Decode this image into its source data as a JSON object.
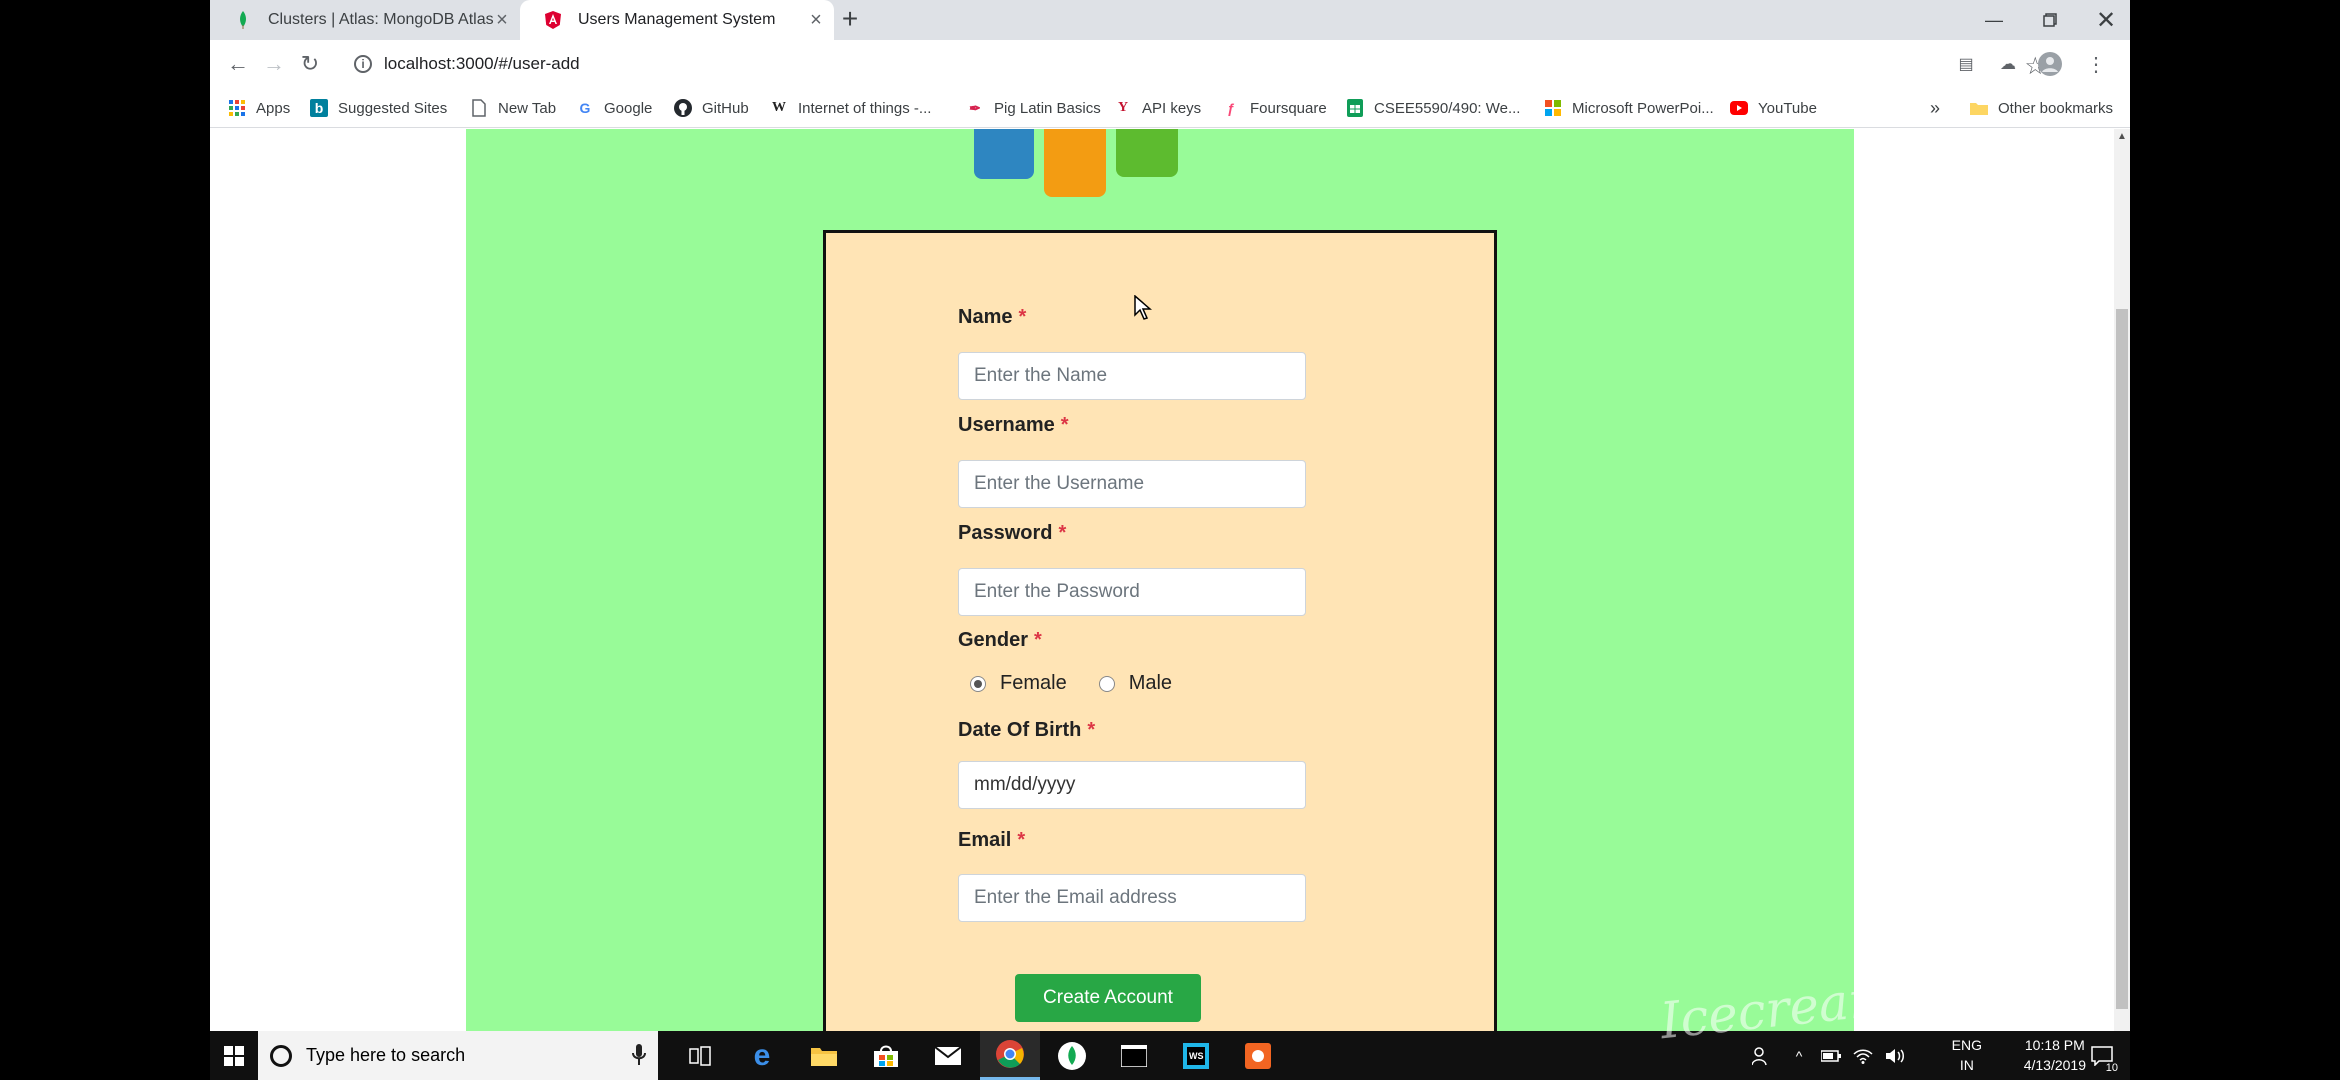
{
  "browser": {
    "tabs": [
      {
        "title": "Clusters | Atlas: MongoDB Atlas",
        "icon": "mongodb-leaf-icon"
      },
      {
        "title": "Users Management System",
        "icon": "angular-icon",
        "active": true
      }
    ],
    "url": "localhost:3000/#/user-add",
    "bookmarks": [
      {
        "label": "Apps",
        "icon": "apps-grid-icon"
      },
      {
        "label": "Suggested Sites",
        "icon": "bing-icon"
      },
      {
        "label": "New Tab",
        "icon": "page-icon"
      },
      {
        "label": "Google",
        "icon": "google-icon"
      },
      {
        "label": "GitHub",
        "icon": "github-icon"
      },
      {
        "label": "Internet of things -...",
        "icon": "wikipedia-icon"
      },
      {
        "label": "Pig Latin Basics",
        "icon": "feather-icon"
      },
      {
        "label": "API keys",
        "icon": "yahoo-icon"
      },
      {
        "label": "Foursquare",
        "icon": "foursquare-icon"
      },
      {
        "label": "CSEE5590/490: We...",
        "icon": "sheets-icon"
      },
      {
        "label": "Microsoft PowerPoi...",
        "icon": "microsoft-icon"
      },
      {
        "label": "YouTube",
        "icon": "youtube-icon"
      }
    ],
    "more_bookmarks": "»",
    "other_bookmarks": "Other bookmarks"
  },
  "form": {
    "required_mark": "*",
    "name": {
      "label": "Name",
      "placeholder": "Enter the Name"
    },
    "username": {
      "label": "Username",
      "placeholder": "Enter the Username"
    },
    "password": {
      "label": "Password",
      "placeholder": "Enter the Password"
    },
    "gender": {
      "label": "Gender",
      "options": [
        "Female",
        "Male"
      ],
      "selected": "Female"
    },
    "dob": {
      "label": "Date Of Birth",
      "placeholder": "mm/dd/yyyy"
    },
    "email": {
      "label": "Email",
      "placeholder": "Enter the Email address"
    },
    "submit_label": "Create Account"
  },
  "taskbar": {
    "search_placeholder": "Type here to search",
    "language": "ENG",
    "region": "IN",
    "time": "10:18 PM",
    "date": "4/13/2019",
    "notification_count": "10"
  },
  "colors": {
    "page_background": "#98fb98",
    "card_background": "#ffe4b5",
    "button": "#28a745",
    "required": "#dc3545"
  }
}
